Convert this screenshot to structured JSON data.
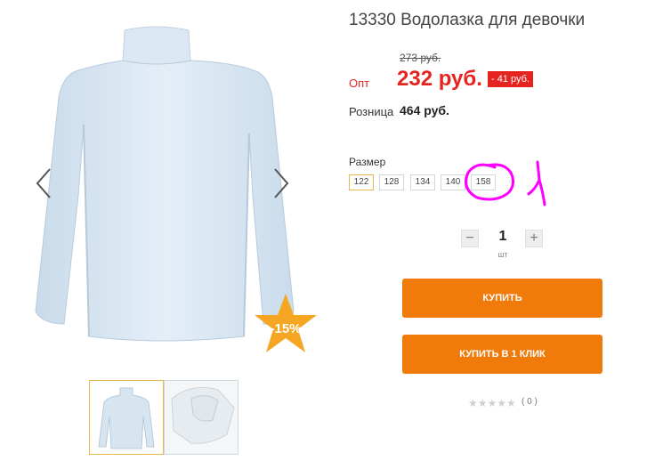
{
  "product": {
    "title": "13330 Водолазка для девочки",
    "old_price": "273 руб.",
    "opt_label": "Опт",
    "price": "232 руб.",
    "discount": "- 41 руб.",
    "retail_label": "Розница",
    "retail_price": "464 руб.",
    "sale_badge": "-15%"
  },
  "sizes": {
    "label": "Размер",
    "options": [
      "122",
      "128",
      "134",
      "140",
      "158"
    ],
    "selected": "122"
  },
  "quantity": {
    "minus": "−",
    "plus": "+",
    "value": "1",
    "unit": "шт"
  },
  "buttons": {
    "buy": "КУПИТЬ",
    "buy_one_click": "КУПИТЬ В 1 КЛИК"
  },
  "rating": {
    "stars": "★★★★★",
    "reviews": "( 0 )"
  },
  "colors": {
    "accent": "#f07a0a",
    "price": "#e52420",
    "annotation": "#ff00ff",
    "badge": "#f5a623"
  },
  "icons": [
    "arrow-left-icon",
    "arrow-right-icon",
    "star-icon"
  ]
}
